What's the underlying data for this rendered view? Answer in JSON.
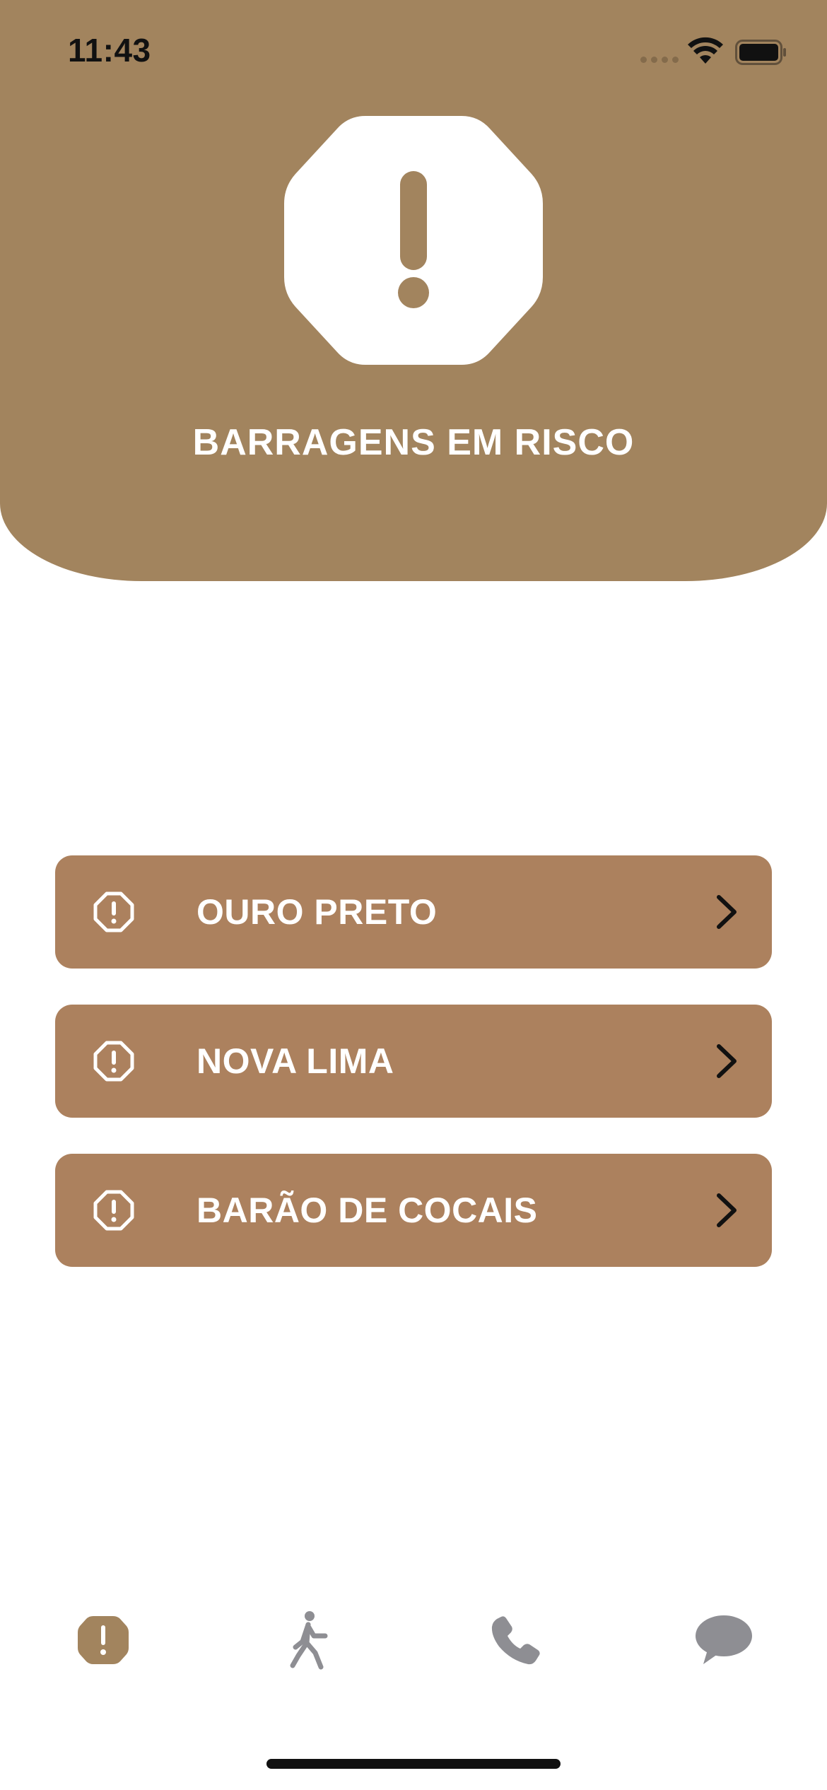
{
  "status_bar": {
    "time": "11:43",
    "icons": [
      "signal-dots-icon",
      "wifi-icon",
      "battery-icon"
    ]
  },
  "header": {
    "icon": "exclamation-octagon-icon",
    "title": "BARRAGENS EM RISCO",
    "background_color": "#a2845e"
  },
  "cities": [
    {
      "label": "OURO PRETO",
      "icon": "exclamation-octagon-outline-icon",
      "trailing_icon": "chevron-right-icon"
    },
    {
      "label": "NOVA LIMA",
      "icon": "exclamation-octagon-outline-icon",
      "trailing_icon": "chevron-right-icon"
    },
    {
      "label": "BARÃO DE COCAIS",
      "icon": "exclamation-octagon-outline-icon",
      "trailing_icon": "chevron-right-icon"
    }
  ],
  "city_button_color": "#ac815e",
  "tab_bar": {
    "tabs": [
      {
        "icon": "exclamation-octagon-icon",
        "selected": true
      },
      {
        "icon": "walking-person-icon",
        "selected": false
      },
      {
        "icon": "phone-icon",
        "selected": false
      },
      {
        "icon": "chat-bubble-icon",
        "selected": false
      }
    ],
    "active_color": "#a2845e",
    "inactive_color": "#8e8e93"
  }
}
